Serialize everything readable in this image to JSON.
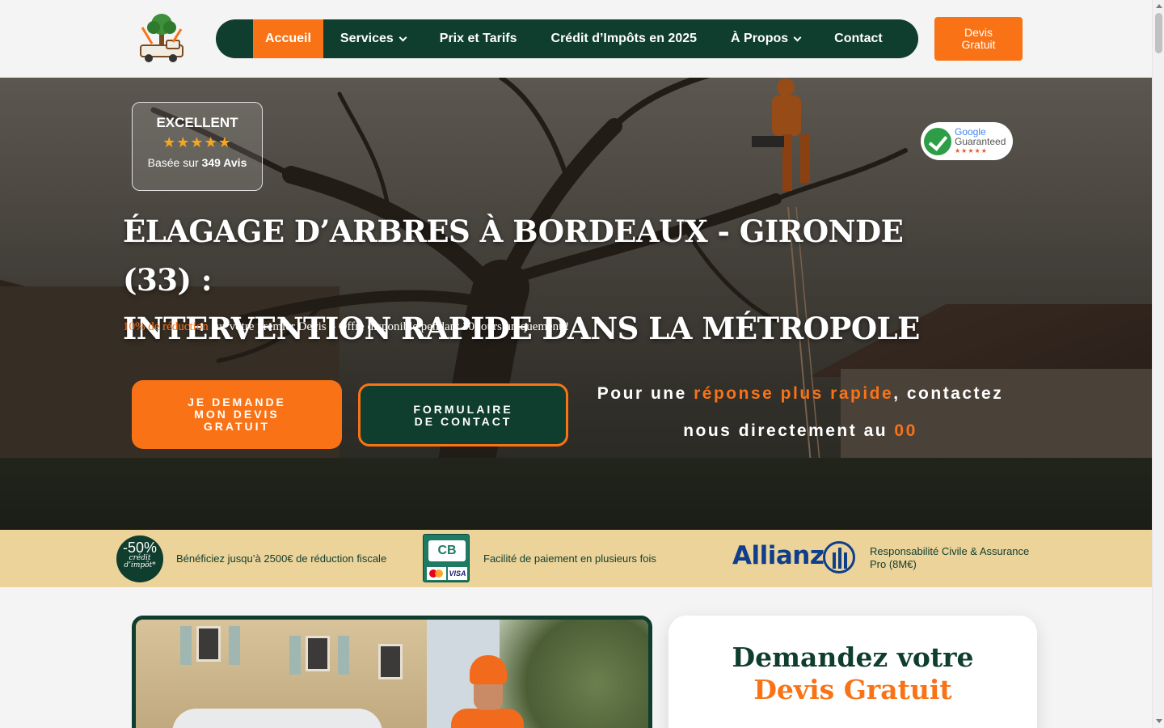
{
  "header": {
    "logo_icon": "tree-truck-logo-icon",
    "nav": [
      {
        "label": "Accueil",
        "active": true,
        "dropdown": false
      },
      {
        "label": "Services",
        "active": false,
        "dropdown": true
      },
      {
        "label": "Prix et Tarifs",
        "active": false,
        "dropdown": false
      },
      {
        "label": "Crédit d’Impôts en 2025",
        "active": false,
        "dropdown": false
      },
      {
        "label": "À Propos",
        "active": false,
        "dropdown": true
      },
      {
        "label": "Contact",
        "active": false,
        "dropdown": false
      }
    ],
    "cta_line1": "Devis",
    "cta_line2": "Gratuit"
  },
  "hero": {
    "review": {
      "title": "EXCELLENT",
      "stars": "★★★★★",
      "based_on": "Basée sur",
      "count": "349 Avis"
    },
    "google_badge": {
      "line1": "Google",
      "line2": "Guaranteed",
      "stars": "★★★★★"
    },
    "title_line1": "ÉLAGAGE D’ARBRES À BORDEAUX - GIRONDE (33) :",
    "title_line2": "INTERVENTION RAPIDE DANS LA MÉTROPOLE",
    "promo_highlight": "10% de réduction",
    "promo_rest": " sur votre premier Devis – Offre disponible pendant 30 jours uniquement !",
    "btn_devis": [
      "JE DEMANDE",
      "MON DEVIS",
      "GRATUIT"
    ],
    "btn_contact": [
      "FORMULAIRE",
      "DE CONTACT"
    ],
    "callout": {
      "part1": "Pour une ",
      "highlight": "réponse plus rapide",
      "part2": ", contactez",
      "part3": "nous directement au ",
      "phone": "00"
    }
  },
  "band": {
    "credit_pct": "-50%",
    "credit_l1": "crédit",
    "credit_l2": "d’impôt*",
    "credit_text": "Bénéficiez jusqu’à 2500€ de réduction fiscale",
    "payment_cb": "CB",
    "payment_visa": "VISA",
    "payment_text": "Facilité de paiement en plusieurs fois",
    "insurer": "Allianz",
    "insurance_l1": "Responsabilité Civile & Assurance",
    "insurance_l2": "Pro (8M€)"
  },
  "form": {
    "title_line1": "Demandez votre",
    "title_line2": "Devis Gratuit"
  },
  "colors": {
    "brand_green": "#0f3d2e",
    "brand_orange": "#f97316",
    "band_bg": "#ecd39a"
  }
}
